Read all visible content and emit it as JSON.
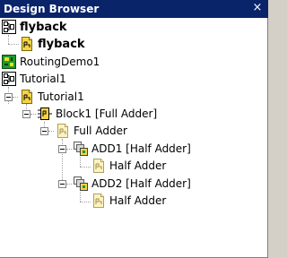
{
  "window": {
    "title": "Design Browser",
    "close_glyph": "×"
  },
  "tree": {
    "items": [
      {
        "label": "flyback",
        "icon": "design-block-icon",
        "bold": true
      },
      {
        "label": "flyback",
        "icon": "schematic-page-icon",
        "bold": true
      },
      {
        "label": "RoutingDemo1",
        "icon": "green-chip-icon",
        "bold": false
      },
      {
        "label": "Tutorial1",
        "icon": "design-block-icon",
        "bold": false
      },
      {
        "label": "Tutorial1",
        "icon": "schematic-page-icon",
        "bold": false,
        "expanded": true
      },
      {
        "label": "Block1 [Full Adder]",
        "icon": "block-component-icon",
        "bold": false,
        "expanded": true
      },
      {
        "label": "Full Adder",
        "icon": "schematic-page-icon",
        "bold": false,
        "expanded": true
      },
      {
        "label": "ADD1 [Half Adder]",
        "icon": "hierarchical-component-icon",
        "bold": false,
        "expanded": true
      },
      {
        "label": "Half Adder",
        "icon": "schematic-page-icon",
        "bold": false
      },
      {
        "label": "ADD2 [Half Adder]",
        "icon": "hierarchical-component-icon",
        "bold": false,
        "expanded": true
      },
      {
        "label": "Half Adder",
        "icon": "schematic-page-icon",
        "bold": false
      }
    ]
  },
  "colors": {
    "titlebar": "#0a246a",
    "tree_lines": "#a0a0a0",
    "page_icon_yellow": "#f5d547",
    "chip_green": "#1f9a2a"
  }
}
